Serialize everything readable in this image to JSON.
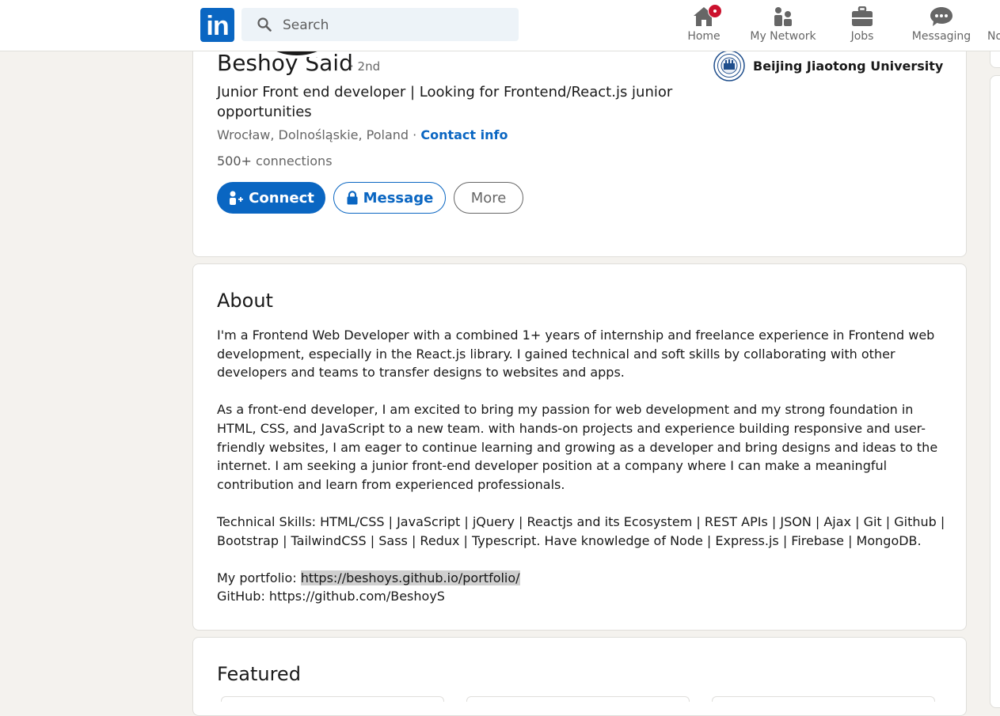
{
  "nav": {
    "logo": "in",
    "search_placeholder": "Search",
    "items": [
      {
        "label": "Home",
        "icon": "home-icon"
      },
      {
        "label": "My Network",
        "icon": "my-network-icon"
      },
      {
        "label": "Jobs",
        "icon": "jobs-icon"
      },
      {
        "label": "Messaging",
        "icon": "messaging-icon"
      },
      {
        "label": "No",
        "icon": "notifications-icon"
      }
    ]
  },
  "profile": {
    "name": "Beshoy Said",
    "degree": "· 2nd",
    "headline": "Junior Front end developer | Looking for Frontend/React.js junior opportunities",
    "location": "Wrocław, Dolnośląskie, Poland",
    "location_sep": " · ",
    "contact_info": "Contact info",
    "connections_count": "500+",
    "connections_label": " connections",
    "school": "Beijing Jiaotong University",
    "buttons": {
      "connect": "Connect",
      "message": "Message",
      "more": "More"
    }
  },
  "about": {
    "title": "About",
    "p1": "I'm a Frontend Web Developer with a combined 1+ years of internship and freelance experience in Frontend web development, especially in the React.js library. I gained technical and soft skills by collaborating with other developers and teams to transfer designs to websites and apps.",
    "p2": "As a front-end developer, I am excited to bring my passion for web development and my strong foundation in HTML, CSS, and JavaScript to a new team. with hands-on projects and experience building responsive and user-friendly websites, I am eager to continue learning and growing as a developer and bring designs and ideas to the internet. I am seeking a junior front-end developer position at a company where I can make a meaningful contribution and learn from experienced professionals.",
    "p3": "Technical Skills: HTML/CSS | JavaScript | jQuery | Reactjs and its Ecosystem | REST APIs | JSON | Ajax | Git | Github | Bootstrap | TailwindCSS | Sass | Redux | Typescript. Have knowledge of Node | Express.js | Firebase | MongoDB.",
    "portfolio_label": "My portfolio: ",
    "portfolio_url": "https://beshoys.github.io/portfolio/",
    "github_line": "GitHub: https://github.com/BeshoyS"
  },
  "featured": {
    "title": "Featured"
  },
  "colors": {
    "brand": "#0a66c2",
    "background": "#f4f2ee",
    "badge": "#cb112d"
  }
}
